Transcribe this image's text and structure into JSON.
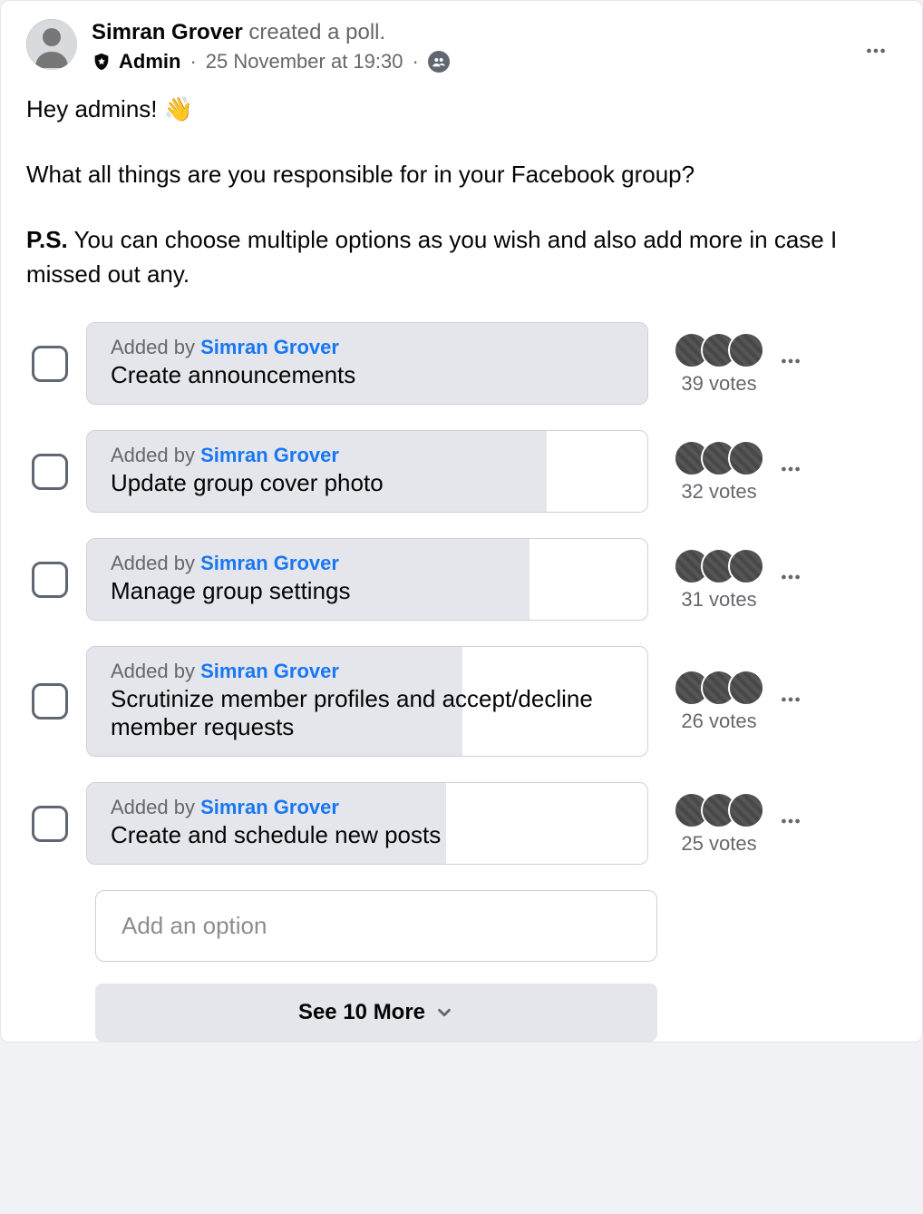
{
  "post": {
    "author": "Simran Grover",
    "action_text": "created a poll.",
    "role": "Admin",
    "timestamp": "25 November at 19:30",
    "audience": "group"
  },
  "body": {
    "greeting": "Hey admins! 👋",
    "question": "What all things are you responsible for in your Facebook group?",
    "ps_label": "P.S.",
    "ps_text": "You can choose multiple options as you wish and also add more in case I missed out any."
  },
  "poll": {
    "max_votes": 39,
    "added_by_prefix": "Added by ",
    "added_by_author": "Simran Grover",
    "votes_suffix": " votes",
    "options": [
      {
        "text": "Create announcements",
        "votes": 39
      },
      {
        "text": "Update group cover photo",
        "votes": 32
      },
      {
        "text": "Manage group settings",
        "votes": 31
      },
      {
        "text": "Scrutinize member profiles and accept/decline member requests",
        "votes": 26
      },
      {
        "text": "Create and schedule new posts",
        "votes": 25
      }
    ],
    "add_option_placeholder": "Add an option",
    "see_more_label": "See 10 More"
  }
}
